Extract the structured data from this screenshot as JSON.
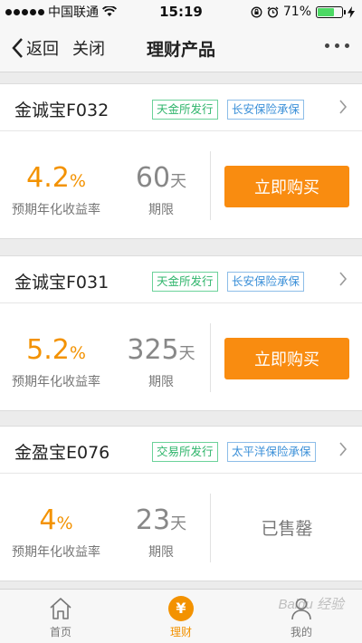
{
  "status_bar": {
    "carrier": "中国联通",
    "time": "15:19",
    "battery_percent": "71%",
    "battery_level": 0.71,
    "battery_color": "#4cd964"
  },
  "nav": {
    "back_label": "返回",
    "close_label": "关闭",
    "title": "理财产品",
    "more_icon": "more-dots-icon"
  },
  "accent_color": "#f39200",
  "button_color": "#f98c10",
  "products": [
    {
      "name": "金诚宝F032",
      "tag1": "天金所发行",
      "tag2": "长安保险承保",
      "rate_value": "4.2",
      "rate_unit": "%",
      "rate_label": "预期年化收益率",
      "term_value": "60",
      "term_unit": "天",
      "term_label": "期限",
      "action": "立即购买"
    },
    {
      "name": "金诚宝F031",
      "tag1": "天金所发行",
      "tag2": "长安保险承保",
      "rate_value": "5.2",
      "rate_unit": "%",
      "rate_label": "预期年化收益率",
      "term_value": "325",
      "term_unit": "天",
      "term_label": "期限",
      "action": "立即购买"
    },
    {
      "name": "金盈宝E076",
      "tag1": "交易所发行",
      "tag2": "太平洋保险承保",
      "rate_value": "4",
      "rate_unit": "%",
      "rate_label": "预期年化收益率",
      "term_value": "23",
      "term_unit": "天",
      "term_label": "期限",
      "status": "已售罄"
    }
  ],
  "tab_bar": {
    "tabs": [
      {
        "label": "首页",
        "icon": "home-icon"
      },
      {
        "label": "理财",
        "icon": "yen-icon",
        "active": true
      },
      {
        "label": "我的",
        "icon": "user-icon"
      }
    ],
    "yen_glyph": "¥"
  },
  "watermark": "Baidu 经验"
}
